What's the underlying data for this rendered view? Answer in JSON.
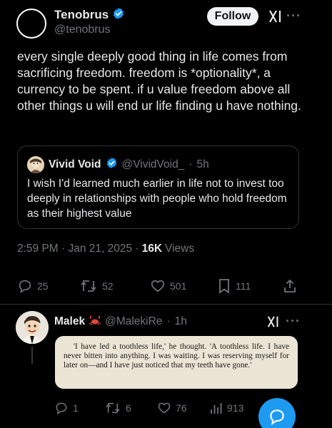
{
  "tweet": {
    "author_name": "Tenobrus",
    "author_handle": "@tenobrus",
    "follow_label": "Follow",
    "more_label": "···",
    "text": "every single deeply good thing in life comes from sacrificing freedom. freedom is *optionality*, a currency to be spent. if u value freedom above all other things u will end ur life finding u have nothing.",
    "time": "2:59 PM · Jan 21, 2025 ·",
    "views_count": "16K",
    "views_label": "Views"
  },
  "quote": {
    "author_name": "Vivid Void",
    "author_handle": "@VividVoid_",
    "separator": "·",
    "time": "5h",
    "text": "I wish I'd learned much earlier in life not to invest too deeply in relationships with people who hold freedom as their highest value"
  },
  "actions": {
    "replies": "25",
    "reposts": "52",
    "likes": "501",
    "bookmarks": "111"
  },
  "reply": {
    "author_name": "Malek",
    "author_handle": "@MalekiRe",
    "separator": "·",
    "time": "1h",
    "more_label": "···",
    "image_text": "'I have led a toothless life,' he thought. 'A toothless life. I have never bitten into anything. I was waiting. I was reserving myself for later on—and I have just noticed that my teeth have gone.'",
    "replies": "1",
    "reposts": "6",
    "likes": "76",
    "views": "913"
  },
  "colors": {
    "background": "#000000",
    "text": "#e7e9ea",
    "muted": "#71767b",
    "accent": "#1d9bf0",
    "verified": "#1d9bf0",
    "border": "#2f3336"
  },
  "icons": [
    "verified-badge-icon",
    "xai-grok-icon",
    "reply-icon",
    "repost-icon",
    "like-icon",
    "bookmark-icon",
    "share-icon",
    "views-icon",
    "crab-emoji-icon",
    "compose-reply-icon"
  ]
}
